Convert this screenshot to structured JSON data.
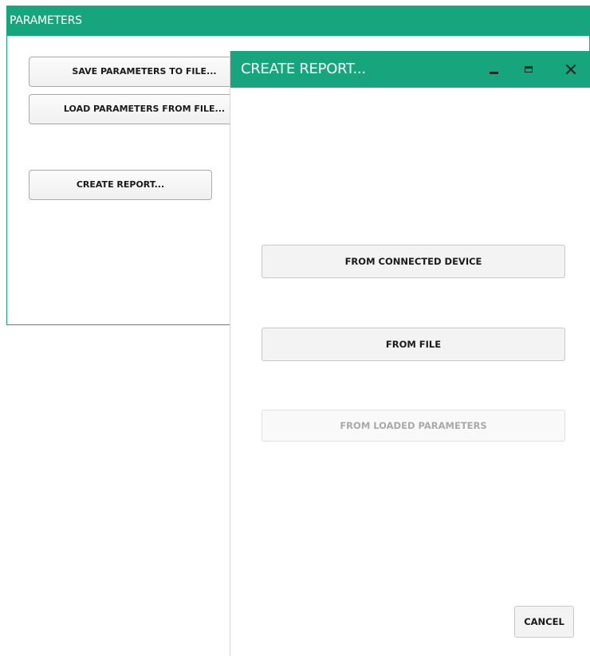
{
  "parameters_panel": {
    "title": "PARAMETERS",
    "save_button": "SAVE PARAMETERS TO FILE...",
    "load_button": "LOAD PARAMETERS FROM FILE...",
    "create_report_button": "CREATE REPORT..."
  },
  "dialog": {
    "title": "CREATE REPORT...",
    "window_controls": {
      "minimize_icon": "minimize-icon",
      "maximize_icon": "maximize-icon",
      "close_icon": "close-icon",
      "close_glyph": "✕"
    },
    "buttons": {
      "from_connected_device": "FROM CONNECTED DEVICE",
      "from_file": "FROM FILE",
      "from_loaded_parameters": "FROM LOADED PARAMETERS",
      "cancel": "CANCEL"
    }
  },
  "colors": {
    "accent": "#17a57d",
    "disabled_text": "#a9a9a9"
  }
}
